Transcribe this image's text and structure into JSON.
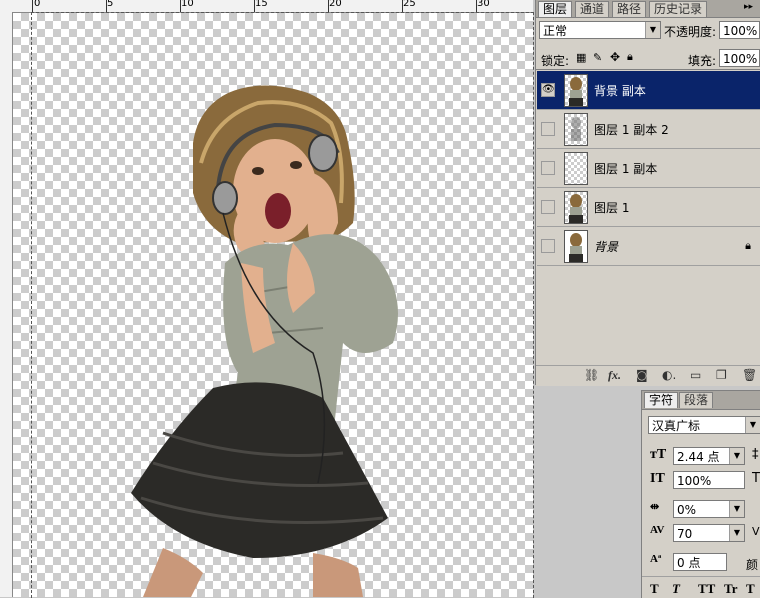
{
  "ruler": {
    "marks": [
      "0",
      "5",
      "10",
      "15",
      "20",
      "25",
      "30"
    ]
  },
  "layers_panel": {
    "tabs": [
      "图层",
      "通道",
      "路径",
      "历史记录"
    ],
    "menu_icon": "panel-menu-arrows",
    "blend_mode": "正常",
    "opacity_label": "不透明度:",
    "opacity_value": "100%",
    "lock_label": "锁定:",
    "fill_label": "填充:",
    "fill_value": "100%",
    "layers": [
      {
        "name": "背景 副本",
        "visible": true,
        "selected": true,
        "locked": false
      },
      {
        "name": "图层 1 副本 2",
        "visible": false,
        "selected": false,
        "locked": false
      },
      {
        "name": "图层 1 副本",
        "visible": false,
        "selected": false,
        "locked": false
      },
      {
        "name": "图层 1",
        "visible": false,
        "selected": false,
        "locked": false
      },
      {
        "name": "背景",
        "visible": false,
        "selected": false,
        "locked": true
      }
    ],
    "bottom_icons": [
      "link-icon",
      "fx-icon",
      "mask-icon",
      "adjustment-icon",
      "group-folder-icon",
      "new-layer-icon",
      "trash-icon"
    ]
  },
  "char_panel": {
    "tabs": [
      "字符",
      "段落"
    ],
    "font_family": "汉真广标",
    "font_size": "2.44 点",
    "vertical_scale": "100%",
    "tracking_ratio": "0%",
    "tracking": "70",
    "baseline_shift": "0 点",
    "color_label": "颜",
    "style_buttons": [
      "T",
      "T",
      "TT",
      "Tr",
      "T"
    ]
  }
}
